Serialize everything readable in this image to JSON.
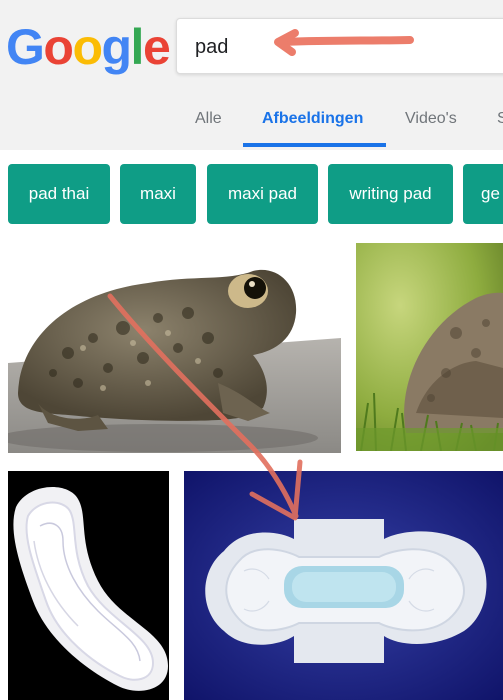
{
  "logo": {
    "letters": [
      "G",
      "o",
      "o",
      "g",
      "l",
      "e"
    ]
  },
  "search": {
    "value": "pad"
  },
  "tabs": [
    {
      "label": "Alle"
    },
    {
      "label": "Afbeeldingen"
    },
    {
      "label": "Video's"
    },
    {
      "label": "S"
    }
  ],
  "chips": [
    {
      "label": "pad thai"
    },
    {
      "label": "maxi"
    },
    {
      "label": "maxi pad"
    },
    {
      "label": "writing pad"
    },
    {
      "label": "ge"
    }
  ],
  "colors": {
    "google_blue": "#4285f4",
    "google_red": "#ea4335",
    "google_yellow": "#fbbc05",
    "google_green": "#34a853",
    "chip_teal": "#0f9d86",
    "annotation_arrow": "#ec7d6b"
  }
}
